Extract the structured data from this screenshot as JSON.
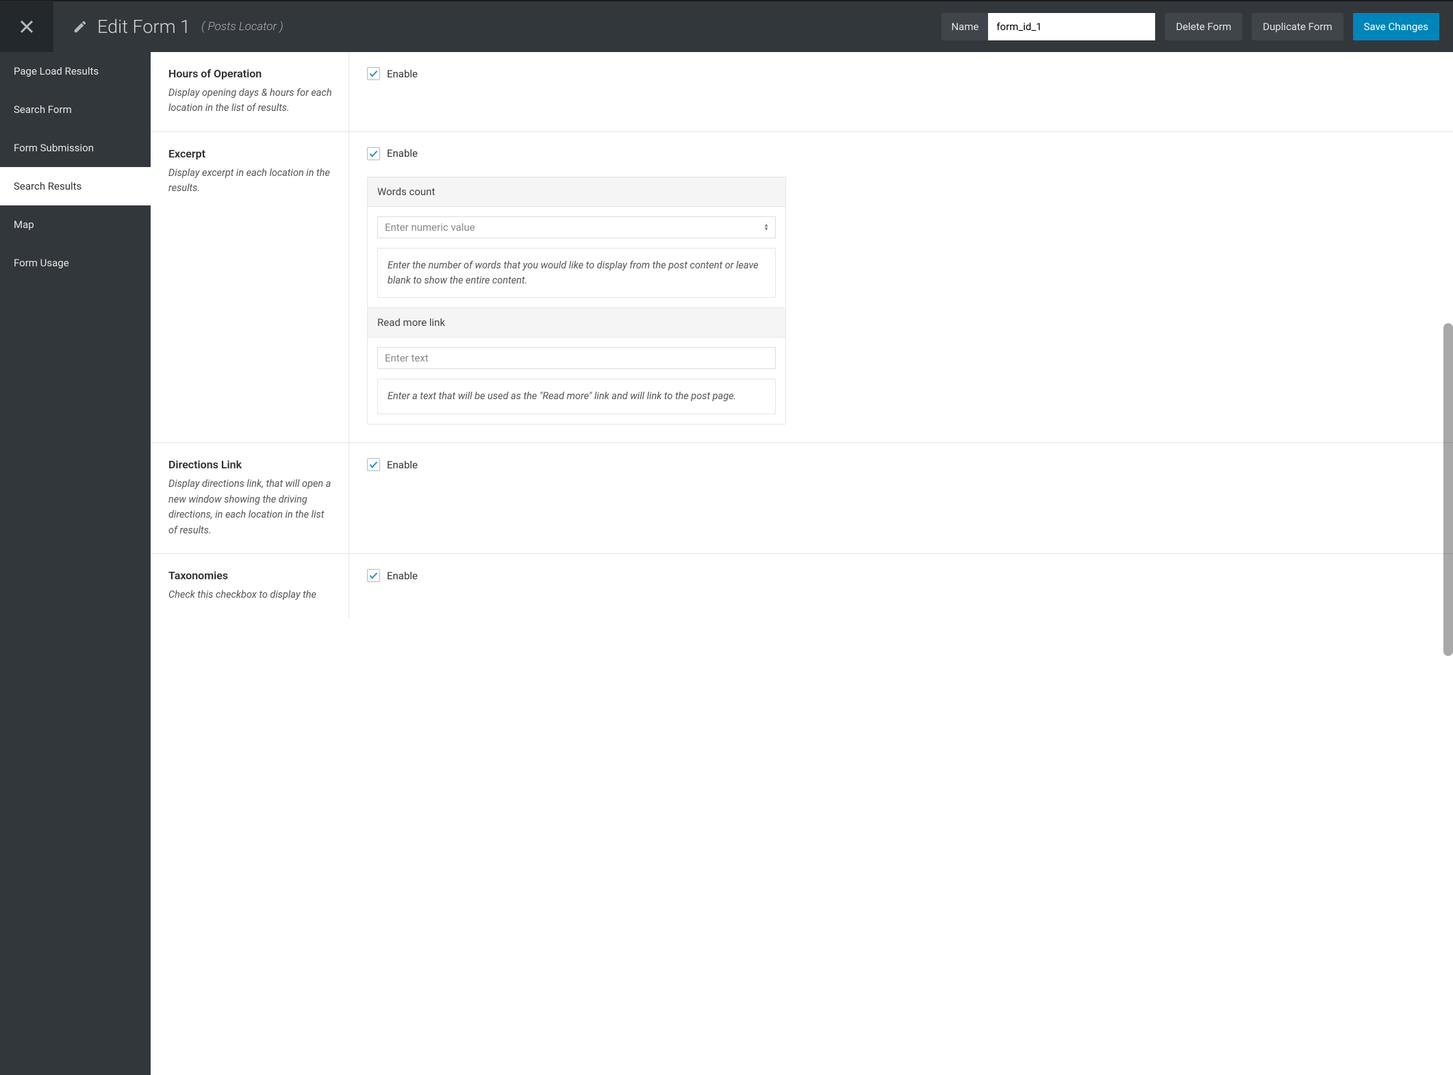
{
  "header": {
    "title": "Edit Form 1",
    "subtitle": "( Posts Locator )",
    "name_label": "Name",
    "name_value": "form_id_1",
    "delete_label": "Delete Form",
    "duplicate_label": "Duplicate Form",
    "save_label": "Save Changes"
  },
  "sidebar": {
    "items": [
      {
        "label": "Page Load Results"
      },
      {
        "label": "Search Form"
      },
      {
        "label": "Form Submission"
      },
      {
        "label": "Search Results"
      },
      {
        "label": "Map"
      },
      {
        "label": "Form Usage"
      }
    ]
  },
  "sections": {
    "hours": {
      "title": "Hours of Operation",
      "desc": "Display opening days & hours for each location in the list of results.",
      "enable_label": "Enable"
    },
    "excerpt": {
      "title": "Excerpt",
      "desc": "Display excerpt in each location in the results.",
      "enable_label": "Enable",
      "words_count": {
        "header": "Words count",
        "placeholder": "Enter numeric value",
        "help": "Enter the number of words that you would like to display from the post content or leave blank to show the entire content."
      },
      "read_more": {
        "header": "Read more link",
        "placeholder": "Enter text",
        "help": "Enter a text that will be used as the \"Read more\" link and will link to the post page."
      }
    },
    "directions": {
      "title": "Directions Link",
      "desc": "Display directions link, that will open a new window showing the driving directions, in each location in the list of results.",
      "enable_label": "Enable"
    },
    "taxonomies": {
      "title": "Taxonomies",
      "desc": "Check this checkbox to display the",
      "enable_label": "Enable"
    }
  }
}
